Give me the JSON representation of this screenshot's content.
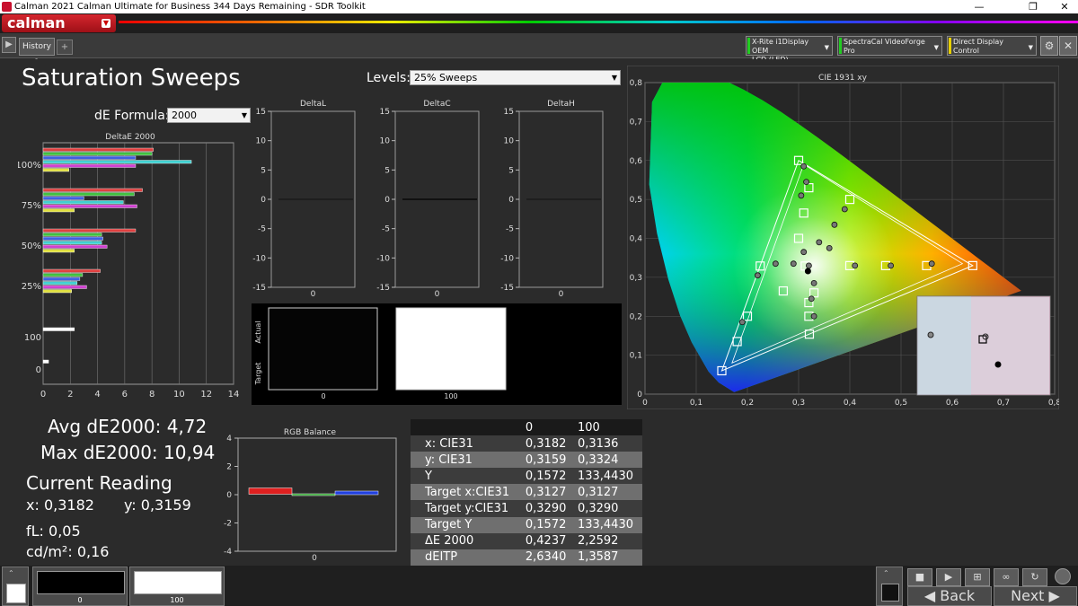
{
  "window": {
    "title": "Calman 2021 Calman Ultimate for Business 344 Days Remaining  - SDR Toolkit",
    "minimize": "—",
    "maximize": "❐",
    "close": "✕"
  },
  "logo": {
    "text": "calman"
  },
  "tabs": {
    "history": "History 1",
    "add": "+"
  },
  "devices": [
    {
      "label_line1": "X-Rite i1Display OEM",
      "label_line2": "LCD (LED)",
      "led": "#22cc22"
    },
    {
      "label_line1": "SpectraCal VideoForge Pro",
      "label_line2": "",
      "led": "#22cc22"
    },
    {
      "label_line1": "Direct Display Control",
      "label_line2": "",
      "led": "#e8d000"
    }
  ],
  "page_title": "Saturation Sweeps",
  "levels": {
    "label": "Levels:",
    "value": "25% Sweeps"
  },
  "de_formula": {
    "label": "dE Formula:",
    "value": "2000"
  },
  "deltae_chart": {
    "title": "DeltaE 2000",
    "group_labels": [
      "100%",
      "75%",
      "50%",
      "25%",
      "100",
      "0"
    ],
    "x_ticks": [
      "0",
      "2",
      "4",
      "6",
      "8",
      "10",
      "12",
      "14"
    ]
  },
  "delta_charts": [
    {
      "title": "DeltaL",
      "y_ticks": [
        "15",
        "10",
        "5",
        "0",
        "-5",
        "-10",
        "-15"
      ],
      "x_label": "0"
    },
    {
      "title": "DeltaC",
      "y_ticks": [
        "15",
        "10",
        "5",
        "0",
        "-5",
        "-10",
        "-15"
      ],
      "x_label": "0"
    },
    {
      "title": "DeltaH",
      "y_ticks": [
        "15",
        "10",
        "5",
        "0",
        "-5",
        "-10",
        "-15"
      ],
      "x_label": "0"
    }
  ],
  "swatch_compare": {
    "actual_label": "Actual",
    "target_label": "Target",
    "labels": [
      "0",
      "100"
    ]
  },
  "stats": {
    "avg": "Avg dE2000: 4,72",
    "max": "Max dE2000: 10,94"
  },
  "current_reading": {
    "title": "Current Reading",
    "x": "x: 0,3182",
    "y": "y: 0,3159",
    "fl": "fL: 0,05",
    "cdm2": "cd/m²: 0,16"
  },
  "rgb_balance": {
    "title": "RGB Balance",
    "y_ticks": [
      "4",
      "2",
      "0",
      "-2",
      "-4"
    ],
    "x_label": "0",
    "colors": [
      "#e02020",
      "#20a020",
      "#2040e0"
    ]
  },
  "cie": {
    "title": "CIE 1931 xy",
    "x_ticks": [
      "0",
      "0,1",
      "0,2",
      "0,3",
      "0,4",
      "0,5",
      "0,6",
      "0,7",
      "0,8"
    ],
    "y_ticks": [
      "0,8",
      "0,7",
      "0,6",
      "0,5",
      "0,4",
      "0,3",
      "0,2",
      "0,1",
      "0"
    ]
  },
  "table": {
    "headers": [
      "",
      "0",
      "100"
    ],
    "rows": [
      [
        "x: CIE31",
        "0,3182",
        "0,3136"
      ],
      [
        "y: CIE31",
        "0,3159",
        "0,3324"
      ],
      [
        "Y",
        "0,1572",
        "133,4430"
      ],
      [
        "Target x:CIE31",
        "0,3127",
        "0,3127"
      ],
      [
        "Target y:CIE31",
        "0,3290",
        "0,3290"
      ],
      [
        "Target Y",
        "0,1572",
        "133,4430"
      ],
      [
        "ΔE 2000",
        "0,4237",
        "2,2592"
      ],
      [
        "dEITP",
        "2,6340",
        "1,3587"
      ]
    ]
  },
  "swatches": [
    {
      "label": "0",
      "color": "#000000"
    },
    {
      "label": "100",
      "color": "#ffffff"
    }
  ],
  "nav": {
    "back": "Back",
    "next": "Next"
  },
  "chart_data": [
    {
      "type": "bar",
      "title": "DeltaE 2000",
      "categories": [
        "100%",
        "75%",
        "50%",
        "25%",
        "100",
        "0"
      ],
      "series": [
        {
          "color": "#e04040",
          "values": [
            8.1,
            7.3,
            6.8,
            4.2,
            0,
            0
          ]
        },
        {
          "color": "#40c040",
          "values": [
            8.0,
            6.7,
            4.3,
            2.9,
            0,
            0
          ]
        },
        {
          "color": "#4060e0",
          "values": [
            6.8,
            3.0,
            4.4,
            2.7,
            0,
            0
          ]
        },
        {
          "color": "#40d0d0",
          "values": [
            10.9,
            5.9,
            4.3,
            2.5,
            0,
            0
          ]
        },
        {
          "color": "#d040d0",
          "values": [
            6.8,
            6.9,
            4.7,
            3.2,
            0,
            0
          ]
        },
        {
          "color": "#e0e040",
          "values": [
            1.9,
            2.3,
            2.3,
            2.1,
            0,
            0
          ]
        },
        {
          "color": "#ffffff",
          "values": [
            0,
            0,
            0,
            0,
            2.3,
            0.4
          ]
        }
      ],
      "xlim": [
        0,
        14
      ]
    },
    {
      "type": "scatter",
      "title": "CIE 1931 xy",
      "xlim": [
        0,
        0.8
      ],
      "ylim": [
        0,
        0.8
      ],
      "gamut_triangle": [
        [
          0.64,
          0.33
        ],
        [
          0.3,
          0.6
        ],
        [
          0.15,
          0.06
        ]
      ],
      "targets": [
        [
          0.64,
          0.33
        ],
        [
          0.3,
          0.6
        ],
        [
          0.15,
          0.06
        ],
        [
          0.225,
          0.329
        ],
        [
          0.321,
          0.154
        ],
        [
          0.4,
          0.5
        ],
        [
          0.32,
          0.53
        ],
        [
          0.31,
          0.465
        ],
        [
          0.3,
          0.4
        ],
        [
          0.55,
          0.33
        ],
        [
          0.47,
          0.33
        ],
        [
          0.4,
          0.33
        ],
        [
          0.27,
          0.265
        ],
        [
          0.2,
          0.2
        ],
        [
          0.18,
          0.135
        ],
        [
          0.33,
          0.26
        ],
        [
          0.32,
          0.235
        ],
        [
          0.32,
          0.2
        ],
        [
          0.313,
          0.329
        ]
      ],
      "measurements": [
        [
          0.56,
          0.335
        ],
        [
          0.48,
          0.33
        ],
        [
          0.41,
          0.33
        ],
        [
          0.29,
          0.335
        ],
        [
          0.32,
          0.33
        ],
        [
          0.31,
          0.585
        ],
        [
          0.315,
          0.545
        ],
        [
          0.305,
          0.51
        ],
        [
          0.39,
          0.475
        ],
        [
          0.37,
          0.435
        ],
        [
          0.34,
          0.39
        ],
        [
          0.36,
          0.375
        ],
        [
          0.31,
          0.365
        ],
        [
          0.255,
          0.335
        ],
        [
          0.22,
          0.305
        ],
        [
          0.33,
          0.285
        ],
        [
          0.325,
          0.245
        ],
        [
          0.33,
          0.2
        ],
        [
          0.19,
          0.185
        ]
      ],
      "current": [
        0.3182,
        0.3159
      ]
    }
  ]
}
